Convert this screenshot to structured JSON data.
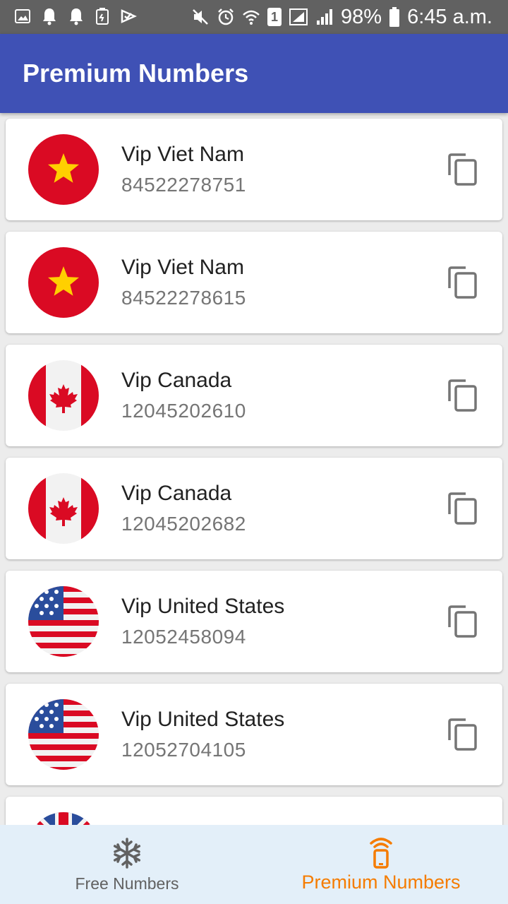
{
  "status_bar": {
    "battery": "98%",
    "time": "6:45 a.m.",
    "sim_label": "1"
  },
  "app_bar": {
    "title": "Premium Numbers"
  },
  "numbers": [
    {
      "country": "Vip Viet Nam",
      "number": "84522278751",
      "flag": "vietnam-flag"
    },
    {
      "country": "Vip Viet Nam",
      "number": "84522278615",
      "flag": "vietnam-flag"
    },
    {
      "country": "Vip Canada",
      "number": "12045202610",
      "flag": "canada-flag"
    },
    {
      "country": "Vip Canada",
      "number": "12045202682",
      "flag": "canada-flag"
    },
    {
      "country": "Vip United States",
      "number": "12052458094",
      "flag": "usa-flag"
    },
    {
      "country": "Vip United States",
      "number": "12052704105",
      "flag": "usa-flag"
    },
    {
      "country": "",
      "number": "",
      "flag": "uk-flag"
    }
  ],
  "bottom_nav": {
    "items": [
      {
        "label": "Free Numbers",
        "icon": "snowflake-icon",
        "active": false
      },
      {
        "label": "Premium Numbers",
        "icon": "phone-signal-icon",
        "active": true
      }
    ],
    "active_color": "#f57c00",
    "inactive_color": "#616161"
  },
  "colors": {
    "app_bar": "#3f51b5",
    "status_bar": "#616161"
  }
}
